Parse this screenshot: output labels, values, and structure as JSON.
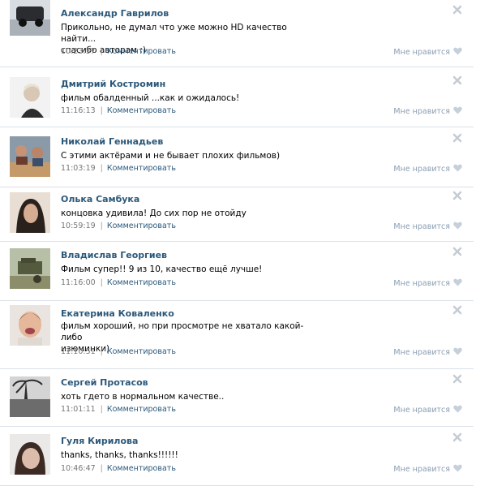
{
  "comments": [
    {
      "author": "Александр Гаврилов",
      "lines": [
        "Прикольно, не думал что уже можно HD качество найти...",
        "спасибо авторам ;)"
      ],
      "time": "10:23:37",
      "reply": "Комментировать",
      "like": "Мне нравится"
    },
    {
      "author": "Дмитрий Костромин",
      "lines": [
        "фильм обалденный ...как и ожидалось!"
      ],
      "time": "11:16:13",
      "reply": "Комментировать",
      "like": "Мне нравится"
    },
    {
      "author": "Николай Геннадьев",
      "lines": [
        "С этими актёрами и не бывает плохих фильмов)"
      ],
      "time": "11:03:19",
      "reply": "Комментировать",
      "like": "Мне нравится"
    },
    {
      "author": "Олька Самбука",
      "lines": [
        "концовка удивила! До сих пор не отойду"
      ],
      "time": "10:59:19",
      "reply": "Комментировать",
      "like": "Мне нравится"
    },
    {
      "author": "Владислав Георгиев",
      "lines": [
        "Фильм супер!! 9 из 10, качество ещё лучше!"
      ],
      "time": "11:16:00",
      "reply": "Комментировать",
      "like": "Мне нравится"
    },
    {
      "author": "Екатерина Коваленко",
      "lines": [
        "фильм хороший, но при просмотре не хватало какой-либо",
        "изюминки)"
      ],
      "time": "11:10:51",
      "reply": "Комментировать",
      "like": "Мне нравится"
    },
    {
      "author": "Сергей Протасов",
      "lines": [
        "хоть гдето в нормальном качестве.."
      ],
      "time": "11:01:11",
      "reply": "Комментировать",
      "like": "Мне нравится"
    },
    {
      "author": "Гуля Кирилова",
      "lines": [
        "thanks, thanks, thanks!!!!!!"
      ],
      "time": "10:46:47",
      "reply": "Комментировать",
      "like": "Мне нравится"
    }
  ],
  "colors": {
    "link": "#2b587a",
    "meta": "#777777",
    "like": "#8a9eb2",
    "divider": "#dae1e8"
  },
  "icons": {
    "close": "close-icon",
    "heart": "heart-icon"
  }
}
